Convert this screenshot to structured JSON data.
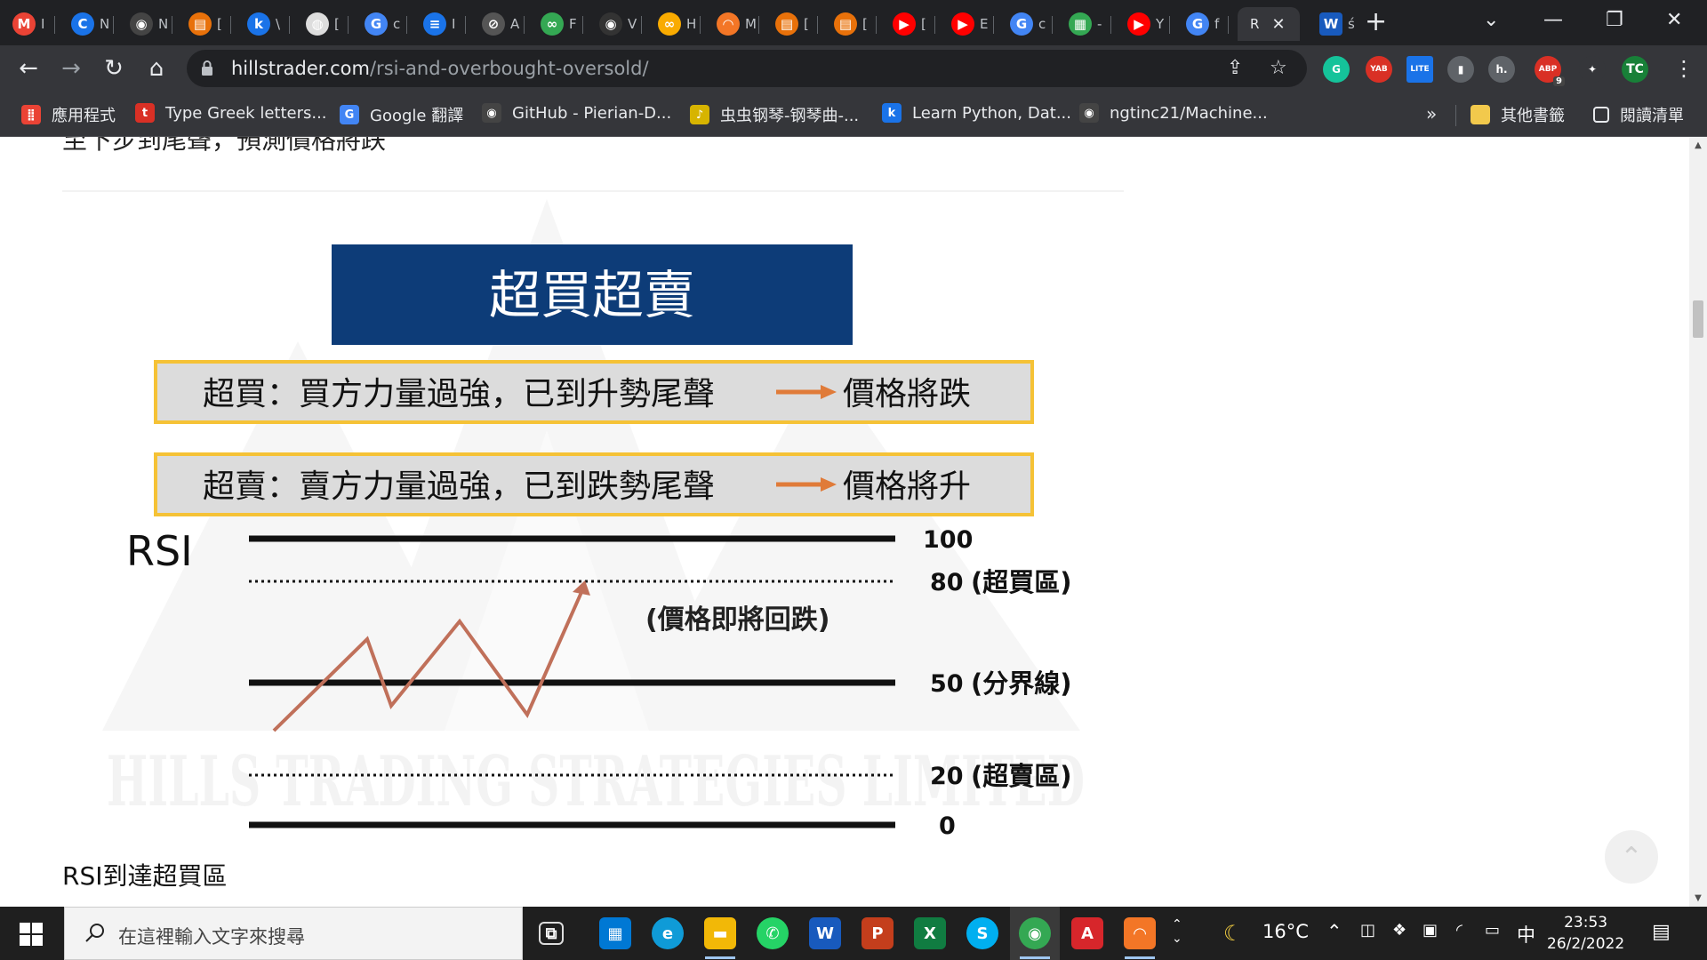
{
  "window": {
    "tabs": [
      {
        "icon": "gmail-icon",
        "short": "I",
        "glyph": "M",
        "color": "#ea4335"
      },
      {
        "icon": "c-app-icon",
        "short": "N",
        "glyph": "C",
        "color": "#1a73e8"
      },
      {
        "icon": "github-icon",
        "short": "N",
        "glyph": "◉",
        "color": "#444444"
      },
      {
        "icon": "book-icon",
        "short": "[",
        "glyph": "▤",
        "color": "#e8710a"
      },
      {
        "icon": "k-app-icon",
        "short": "\\",
        "glyph": "k",
        "color": "#1a73e8"
      },
      {
        "icon": "globe-icon",
        "short": "[",
        "glyph": "◍",
        "color": "#dddddd"
      },
      {
        "icon": "google-icon",
        "short": "c",
        "glyph": "G",
        "color": "#4285f4"
      },
      {
        "icon": "stripes-icon",
        "short": "I",
        "glyph": "≡",
        "color": "#1a73e8"
      },
      {
        "icon": "circle-p-icon",
        "short": "A",
        "glyph": "⊘",
        "color": "#555555"
      },
      {
        "icon": "green-leaf-icon",
        "short": "F",
        "glyph": "∞",
        "color": "#34a853"
      },
      {
        "icon": "github-icon",
        "short": "V",
        "glyph": "◉",
        "color": "#333333"
      },
      {
        "icon": "co-icon",
        "short": "H",
        "glyph": "∞",
        "color": "#f9ab00"
      },
      {
        "icon": "jupyter-icon",
        "short": "M",
        "glyph": "◠",
        "color": "#f37626"
      },
      {
        "icon": "book-icon",
        "short": "[",
        "glyph": "▤",
        "color": "#e8710a"
      },
      {
        "icon": "book-icon",
        "short": "[",
        "glyph": "▤",
        "color": "#e8710a"
      },
      {
        "icon": "youtube-icon",
        "short": "[",
        "glyph": "▶",
        "color": "#ff0000"
      },
      {
        "icon": "youtube-icon",
        "short": "E",
        "glyph": "▶",
        "color": "#ff0000"
      },
      {
        "icon": "google-icon",
        "short": "c",
        "glyph": "G",
        "color": "#4285f4"
      },
      {
        "icon": "map-icon",
        "short": "-",
        "glyph": "▦",
        "color": "#34a853"
      },
      {
        "icon": "youtube-icon",
        "short": "Y",
        "glyph": "▶",
        "color": "#ff0000"
      },
      {
        "icon": "google-icon",
        "short": "f",
        "glyph": "G",
        "color": "#4285f4"
      }
    ],
    "active_tab": {
      "title": "R"
    },
    "last_tab": {
      "icon": "word-icon",
      "short": "ś",
      "glyph": "W",
      "color": "#185abd"
    },
    "controls": {
      "dropdown": "⌄",
      "minimize": "—",
      "restore": "❐",
      "close": "✕"
    }
  },
  "toolbar": {
    "back": "←",
    "forward": "→",
    "reload": "↻",
    "home": "⌂",
    "url_host": "hillstrader.com",
    "url_path": "/rsi-and-overbought-oversold/",
    "share": "⇪",
    "star": "☆",
    "extensions": [
      {
        "name": "grammarly-icon",
        "label": "G",
        "color": "#15c39a"
      },
      {
        "name": "yab-icon",
        "label": "YAB",
        "color": "#d93025"
      },
      {
        "name": "lite-icon",
        "label": "LITE",
        "color": "#1a73e8"
      },
      {
        "name": "office-icon",
        "label": "▮",
        "color": "#5f6368"
      },
      {
        "name": "h-icon",
        "label": "h.",
        "color": "#5f6368"
      },
      {
        "name": "adblock-icon",
        "label": "ABP",
        "color": "#d93025"
      },
      {
        "name": "puzzle-icon",
        "label": "✦",
        "color": "#35363a"
      },
      {
        "name": "profile-avatar",
        "label": "TC",
        "color": "#188038"
      }
    ],
    "adblock_count": "9",
    "menu": "⋮"
  },
  "bookmarks": {
    "items": [
      {
        "icon": "apps-grid-icon",
        "glyph": "⣿",
        "color": "#ea4335",
        "label": "應用程式"
      },
      {
        "icon": "typegreek-icon",
        "glyph": "t",
        "color": "#d93025",
        "label": "Type Greek letters..."
      },
      {
        "icon": "google-translate-icon",
        "glyph": "G",
        "color": "#4285f4",
        "label": "Google 翻譯"
      },
      {
        "icon": "github-icon",
        "glyph": "◉",
        "color": "#444444",
        "label": "GitHub - Pierian-D..."
      },
      {
        "icon": "piano-icon",
        "glyph": "♪",
        "color": "#d7b400",
        "label": "虫虫钢琴-钢琴曲-..."
      },
      {
        "icon": "k-icon",
        "glyph": "k",
        "color": "#1a73e8",
        "label": "Learn Python, Dat..."
      },
      {
        "icon": "github-icon",
        "glyph": "◉",
        "color": "#444444",
        "label": "ngtinc21/Machine..."
      }
    ],
    "overflow": "»",
    "other": "其他書籤",
    "reading_list": "閱讀清單"
  },
  "page": {
    "cut_heading": "至下步到尾聲，預測價格將跌",
    "caption": "RSI到達超買區",
    "scroll_top": "⌃"
  },
  "figure": {
    "title": "超買超賣",
    "box_overbought": {
      "left": "超買：買方力量過強，已到升勢尾聲",
      "right": "價格將跌"
    },
    "box_oversold": {
      "left": "超賣：賣方力量過強，已到跌勢尾聲",
      "right": "價格將升"
    },
    "rsi_label": "RSI",
    "levels": [
      {
        "value": 100,
        "label": "100",
        "desc": "",
        "style": "solid"
      },
      {
        "value": 80,
        "label": "80",
        "desc": "(超買區)",
        "style": "dotted"
      },
      {
        "value": 50,
        "label": "50",
        "desc": "(分界線)",
        "style": "solid"
      },
      {
        "value": 20,
        "label": "20",
        "desc": "(超賣區)",
        "style": "dotted"
      },
      {
        "value": 0,
        "label": "0",
        "desc": "",
        "style": "solid"
      }
    ],
    "annotation": "(價格即將回跌)",
    "watermark": "HILLS TRADING STRATEGIES LIMITED",
    "colors": {
      "title_bg": "#0d3c78",
      "box_border": "#f5c236",
      "box_bg": "#dcdcdc",
      "arrow": "#e07b39",
      "path": "#c0705a"
    }
  },
  "taskbar": {
    "search_placeholder": "在這裡輸入文字來搜尋",
    "apps": [
      {
        "icon": "task-view-icon",
        "glyph": "⧉",
        "color": "#1f1f1f"
      },
      {
        "icon": "store-icon",
        "glyph": "▦",
        "color": "#0078d4"
      },
      {
        "icon": "edge-icon",
        "glyph": "e",
        "color": "#0f9bd7"
      },
      {
        "icon": "file-explorer-icon",
        "glyph": "▬",
        "color": "#f2b807"
      },
      {
        "icon": "whatsapp-icon",
        "glyph": "✆",
        "color": "#25d366"
      },
      {
        "icon": "word-icon",
        "glyph": "W",
        "color": "#185abd"
      },
      {
        "icon": "powerpoint-icon",
        "glyph": "P",
        "color": "#c43e1c"
      },
      {
        "icon": "excel-icon",
        "glyph": "X",
        "color": "#107c41"
      },
      {
        "icon": "skype-icon",
        "glyph": "S",
        "color": "#00aff0"
      },
      {
        "icon": "chrome-icon",
        "glyph": "◉",
        "color": "#34a853"
      },
      {
        "icon": "acrobat-icon",
        "glyph": "A",
        "color": "#d7262b"
      },
      {
        "icon": "jupyter-icon",
        "glyph": "◠",
        "color": "#f37626"
      }
    ],
    "weather_temp": "16°C",
    "weather_icon": "☾",
    "input_method": "中",
    "time": "23:53",
    "date": "26/2/2022"
  }
}
